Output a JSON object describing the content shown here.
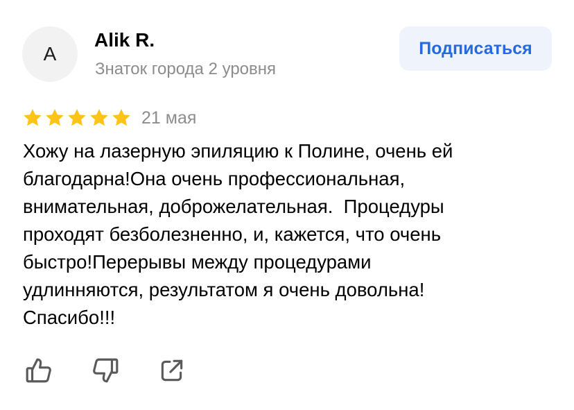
{
  "author": {
    "initial": "A",
    "name": "Alik R.",
    "level": "Знаток города 2 уровня"
  },
  "subscribe_button": {
    "label": "Подписаться"
  },
  "review": {
    "rating": 5,
    "rating_max": 5,
    "date": "21 мая",
    "text": "Хожу на лазерную эпиляцию к Полине, очень ей\nблагодарна!Она очень профессиональная,\nвнимательная, доброжелательная.  Процедуры\nпроходят безболезненно, и, кажется, что очень\nбыстро!Перерывы между процедурами\nудлинняются, результатом я очень довольна!\nСпасибо!!!"
  },
  "actions": [
    {
      "icon": "thumbs-up-icon"
    },
    {
      "icon": "thumbs-down-icon"
    },
    {
      "icon": "share-icon"
    }
  ],
  "colors": {
    "star": "#fcc318",
    "accent": "#2669e0",
    "button_bg": "#eef3fc",
    "muted_text": "#8c8c8c",
    "avatar_bg": "#f2f2f2",
    "icon": "#5a5a5a"
  }
}
